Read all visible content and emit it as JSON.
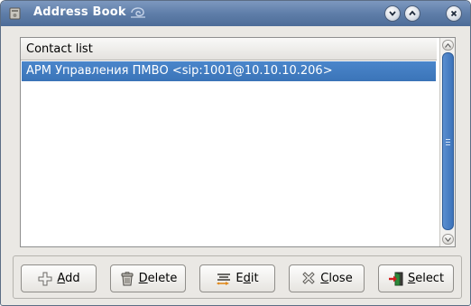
{
  "window": {
    "title": "Address Book",
    "titlebar_icons": [
      "address-book-app-icon",
      "swirl-decoration-icon"
    ],
    "controls": [
      "minimize-button",
      "maximize-button",
      "close-button"
    ]
  },
  "contact_list": {
    "header": "Contact list",
    "rows": [
      {
        "text": "АРМ Управления ПМВО <sip:1001@10.10.10.206>",
        "selected": true
      }
    ]
  },
  "buttons": {
    "add": {
      "mnemonic": "A",
      "rest": "dd",
      "icon": "plus-icon"
    },
    "delete": {
      "mnemonic": "D",
      "rest": "elete",
      "icon": "trash-can-icon"
    },
    "edit": {
      "pre": "E",
      "mnemonic": "d",
      "rest": "it",
      "icon": "edit-lines-icon"
    },
    "close": {
      "mnemonic": "C",
      "rest": "lose",
      "icon": "x-icon"
    },
    "select": {
      "mnemonic": "S",
      "rest": "elect",
      "icon": "door-exit-icon"
    }
  },
  "colors": {
    "titlebar": "#5f7ea9",
    "selection": "#4a86cb",
    "window_bg": "#eae8e4"
  }
}
